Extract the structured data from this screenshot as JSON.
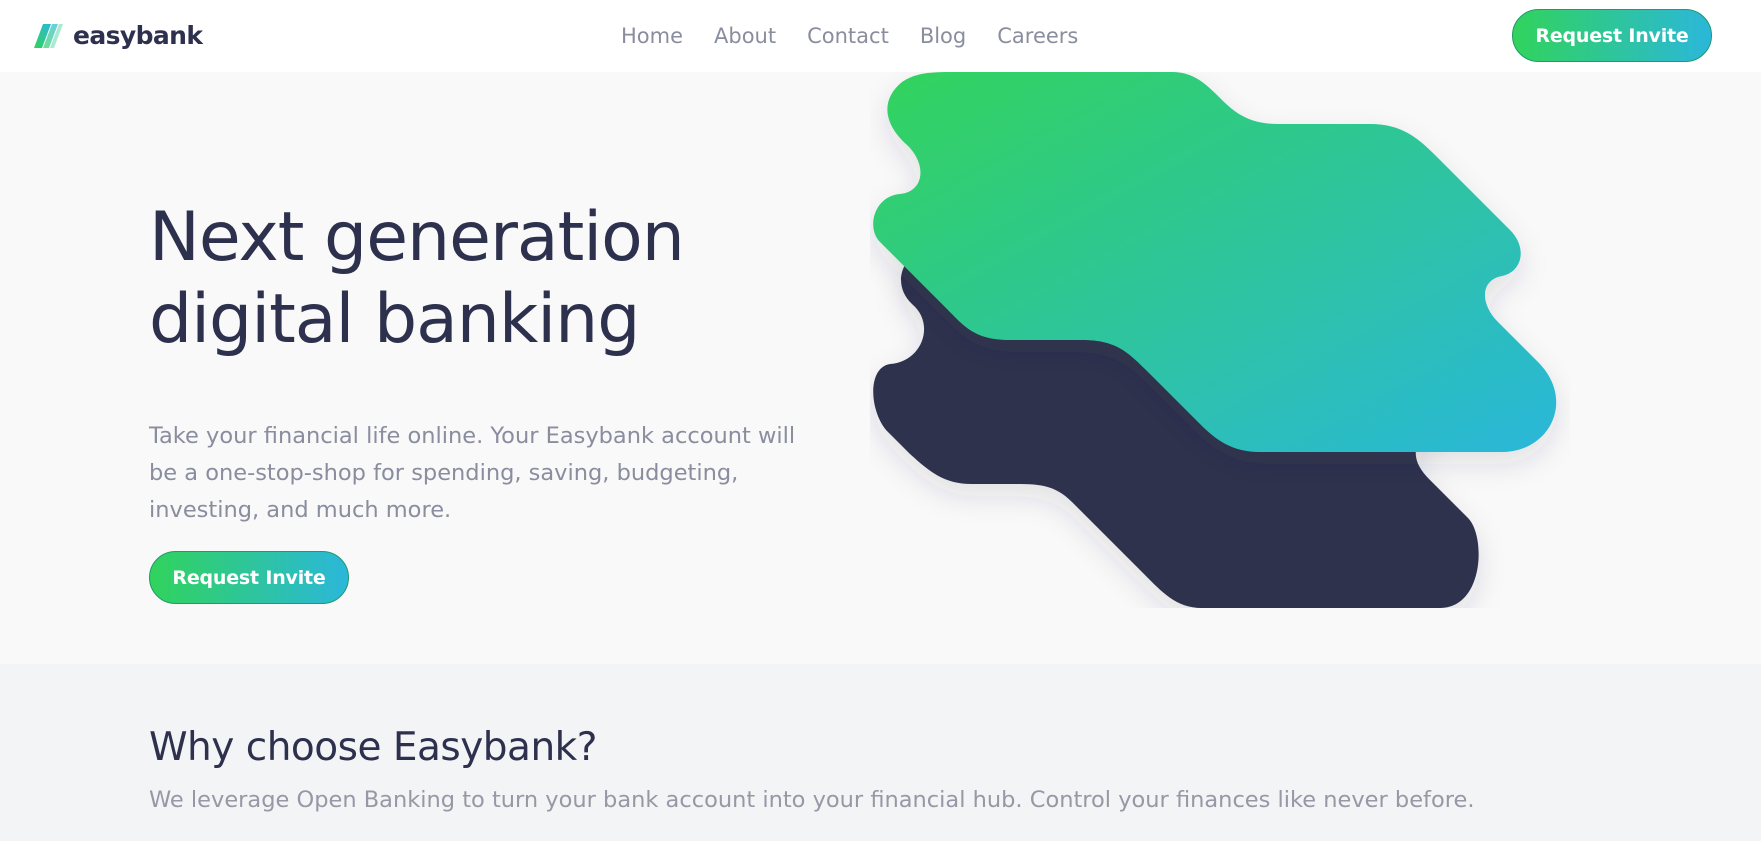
{
  "brand": {
    "name": "easybank",
    "logo_icon": "easybank-stripes-logo",
    "colors": {
      "primary_dark": "#2d314d",
      "accent_green": "#31d35c",
      "accent_cyan": "#2bb7da",
      "text_gray": "#8a8d9e",
      "hero_bg": "#f9f9f9",
      "section_bg": "#f3f4f6"
    }
  },
  "nav": {
    "items": [
      {
        "label": "Home"
      },
      {
        "label": "About"
      },
      {
        "label": "Contact"
      },
      {
        "label": "Blog"
      },
      {
        "label": "Careers"
      }
    ]
  },
  "header": {
    "cta_label": "Request Invite"
  },
  "hero": {
    "title_line1": "Next generation",
    "title_line2": "digital banking",
    "description": "Take your financial life online. Your Easybank account will be a one-stop-shop for spending, saving, budgeting, investing, and much more.",
    "cta_label": "Request Invite",
    "illustration": "abstract-layered-shapes-illustration"
  },
  "why": {
    "title": "Why choose Easybank?",
    "description": "We leverage Open Banking to turn your bank account into your financial hub. Control your finances like never before."
  }
}
